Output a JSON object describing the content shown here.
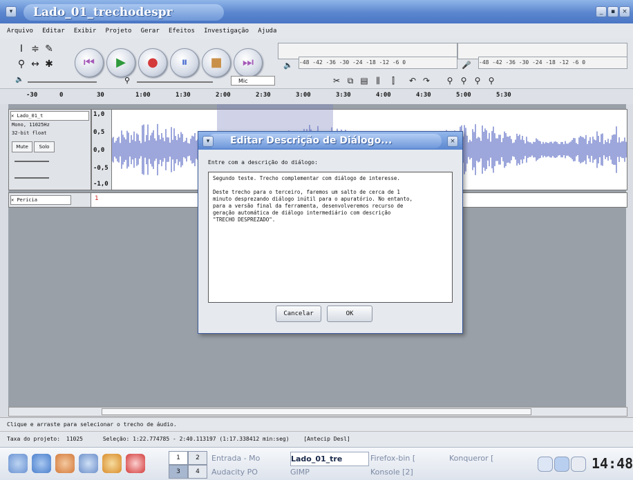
{
  "window": {
    "title": "Lado_01_trechodespr"
  },
  "menu": [
    "Arquivo",
    "Editar",
    "Exibir",
    "Projeto",
    "Gerar",
    "Efeitos",
    "Investigação",
    "Ajuda"
  ],
  "toolbar": {
    "meter_out_scale": "-48 -42 -36 -30 -24 -18 -12 -6 0",
    "meter_in_scale": "-48 -42 -36 -30 -24 -18 -12 -6 0",
    "input_source": "Mic"
  },
  "ruler": [
    "-30",
    "0",
    "30",
    "1:00",
    "1:30",
    "2:00",
    "2:30",
    "3:00",
    "3:30",
    "4:00",
    "4:30",
    "5:00",
    "5:30"
  ],
  "track1": {
    "name": "Lado_01_t",
    "info1": "Mono, 11025Hz",
    "info2": "32-bit float",
    "mute": "Mute",
    "solo": "Solo",
    "scale": [
      "1,0",
      "0,5",
      "0,0",
      "-0,5",
      "-1,0"
    ]
  },
  "track2": {
    "name": "Pericia",
    "marker": "1"
  },
  "dialog": {
    "title": "Editar Descrição de Diálogo...",
    "prompt": "Entre com a descrição do diálogo:",
    "text": "Segundo teste. Trecho complementar com diálogo de interesse.\n\nDeste trecho para o terceiro, faremos um salto de cerca de 1\nminuto desprezando diálogo inútil para o apuratório. No entanto,\npara a versão final da ferramenta, desenvolveremos recurso de\ngeração automática de diálogo intermediário com descrição\n\"TRECHO DESPREZADO\".",
    "cancel": "Cancelar",
    "ok": "OK"
  },
  "status": {
    "hint": "Clique e arraste para selecionar o trecho de áudio.",
    "rate_label": "Taxa do projeto:",
    "rate_value": "11025",
    "selection": "Seleção: 1:22.774785 - 2:40.113197 (1:17.338412 min:seg)",
    "snap": "[Antecip Desl]"
  },
  "taskbar": {
    "desktops": [
      "1",
      "2",
      "3",
      "4"
    ],
    "tasks": [
      "Entrada - Mo",
      "Lado_01_tre",
      "Firefox-bin [",
      "Konqueror [",
      "Audacity PO",
      "GIMP",
      "Konsole [2]"
    ],
    "clock": "14:48"
  }
}
